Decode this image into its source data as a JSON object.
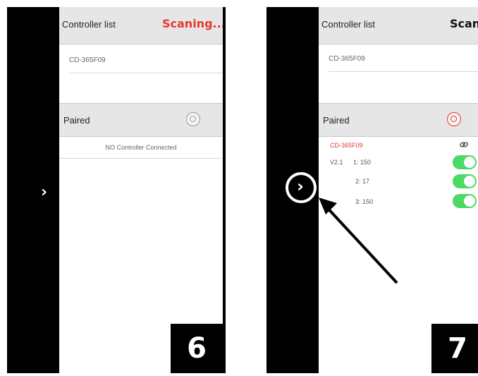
{
  "panel_left": {
    "step_number": "6",
    "header": {
      "title": "Controller list",
      "status": "Scaning..."
    },
    "controllers": [
      "CD-365F09"
    ],
    "paired": {
      "label": "Paired",
      "empty_message": "NO Controller Connected"
    },
    "expand_glyph": "›"
  },
  "panel_right": {
    "step_number": "7",
    "header": {
      "title": "Controller list",
      "status": "Scan"
    },
    "controllers": [
      "CD-365F09"
    ],
    "paired": {
      "label": "Paired",
      "device_name": "CD-365F09",
      "version": "V2.1",
      "link_icon": "link-icon",
      "channels": [
        {
          "label": "1:  150",
          "on": true
        },
        {
          "label": "2:  17",
          "on": true
        },
        {
          "label": "3:  150",
          "on": true
        }
      ]
    },
    "expand_glyph": "›"
  },
  "colors": {
    "accent_red": "#e8382d",
    "toggle_green": "#4cd964",
    "header_gray": "#e6e6e6"
  }
}
